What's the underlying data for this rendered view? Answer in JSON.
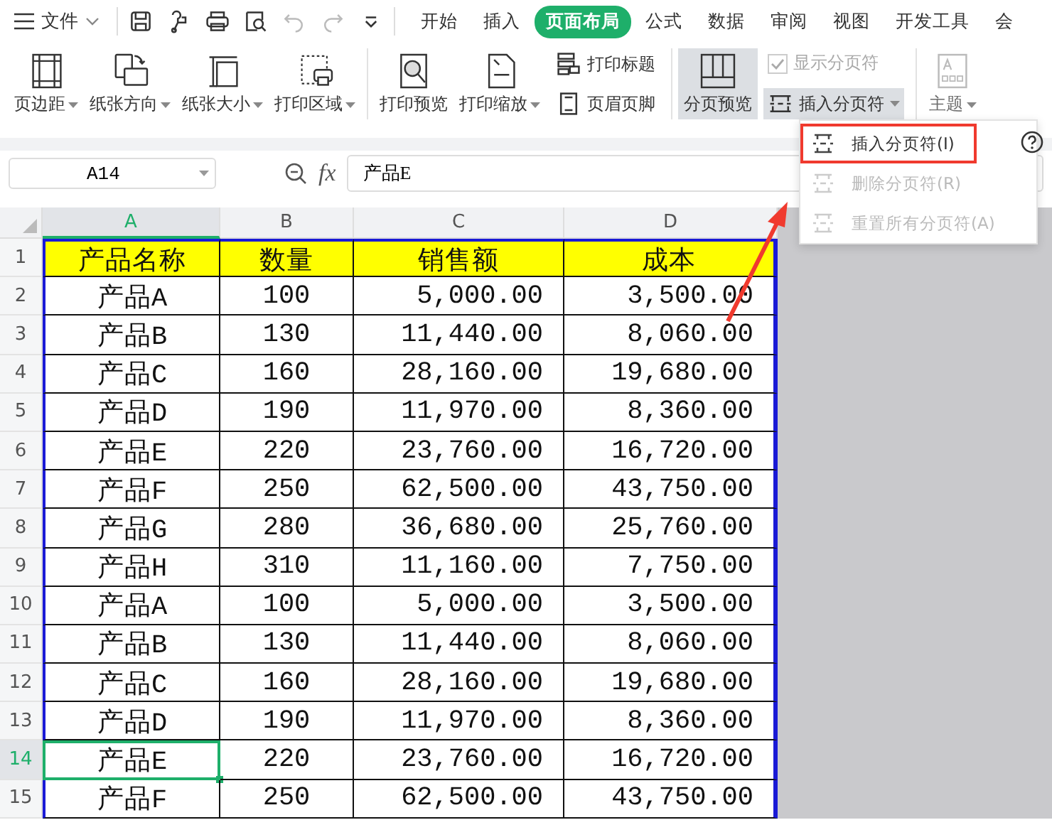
{
  "file_menu": {
    "label": "文件"
  },
  "quick_tools": [
    {
      "disabled": false
    },
    {
      "disabled": false
    },
    {
      "disabled": false
    },
    {
      "disabled": false
    },
    {
      "disabled": true
    },
    {
      "disabled": true
    },
    {
      "disabled": false
    }
  ],
  "tabs": [
    {
      "label": "开始",
      "selected": false
    },
    {
      "label": "插入",
      "selected": false
    },
    {
      "label": "页面布局",
      "selected": true
    },
    {
      "label": "公式",
      "selected": false
    },
    {
      "label": "数据",
      "selected": false
    },
    {
      "label": "审阅",
      "selected": false
    },
    {
      "label": "视图",
      "selected": false
    },
    {
      "label": "开发工具",
      "selected": false
    },
    {
      "label": "会",
      "selected": false
    }
  ],
  "ribbon": [
    {
      "kind": "large",
      "label": "页边距",
      "dropdown": true,
      "selected": false,
      "disabled": false
    },
    {
      "kind": "large",
      "label": "纸张方向",
      "dropdown": true,
      "selected": false,
      "disabled": false
    },
    {
      "kind": "large",
      "label": "纸张大小",
      "dropdown": true,
      "selected": false,
      "disabled": false
    },
    {
      "kind": "large",
      "label": "打印区域",
      "dropdown": true,
      "selected": false,
      "disabled": false
    },
    {
      "kind": "separator"
    },
    {
      "kind": "large",
      "label": "打印预览",
      "dropdown": false,
      "selected": false,
      "disabled": false
    },
    {
      "kind": "large",
      "label": "打印缩放",
      "dropdown": true,
      "selected": false,
      "disabled": false
    },
    {
      "kind": "stack",
      "items": [
        {
          "kind": "button",
          "label": "打印标题",
          "dropdown": false,
          "selected": false,
          "disabled": false
        },
        {
          "kind": "button",
          "label": "页眉页脚",
          "dropdown": false,
          "selected": false,
          "disabled": false
        }
      ]
    },
    {
      "kind": "separator"
    },
    {
      "kind": "large",
      "label": "分页预览",
      "dropdown": false,
      "selected": true,
      "disabled": false
    },
    {
      "kind": "stack",
      "items": [
        {
          "kind": "checkbox",
          "label": "显示分页符",
          "checked": true,
          "disabled": true
        },
        {
          "kind": "button",
          "label": "插入分页符",
          "dropdown": true,
          "selected": true,
          "disabled": false
        }
      ]
    },
    {
      "kind": "separator"
    },
    {
      "kind": "large",
      "label": "主题",
      "dropdown": true,
      "selected": false,
      "disabled": true
    }
  ],
  "name_box": {
    "value": "A14"
  },
  "formula_bar": {
    "fx": "fx",
    "value": "产品E"
  },
  "columns": [
    {
      "label": "A",
      "selected": true
    },
    {
      "label": "B",
      "selected": false
    },
    {
      "label": "C",
      "selected": false
    },
    {
      "label": "D",
      "selected": false
    }
  ],
  "rows": [
    {
      "number": "1",
      "selected": false,
      "header": true,
      "cells": [
        "产品名称",
        "数量",
        "销售额",
        "成本"
      ]
    },
    {
      "number": "2",
      "selected": false,
      "header": false,
      "cells": [
        "产品A",
        "100",
        "5,000.00",
        "3,500.00"
      ]
    },
    {
      "number": "3",
      "selected": false,
      "header": false,
      "cells": [
        "产品B",
        "130",
        "11,440.00",
        "8,060.00"
      ]
    },
    {
      "number": "4",
      "selected": false,
      "header": false,
      "cells": [
        "产品C",
        "160",
        "28,160.00",
        "19,680.00"
      ]
    },
    {
      "number": "5",
      "selected": false,
      "header": false,
      "cells": [
        "产品D",
        "190",
        "11,970.00",
        "8,360.00"
      ]
    },
    {
      "number": "6",
      "selected": false,
      "header": false,
      "cells": [
        "产品E",
        "220",
        "23,760.00",
        "16,720.00"
      ]
    },
    {
      "number": "7",
      "selected": false,
      "header": false,
      "cells": [
        "产品F",
        "250",
        "62,500.00",
        "43,750.00"
      ]
    },
    {
      "number": "8",
      "selected": false,
      "header": false,
      "cells": [
        "产品G",
        "280",
        "36,680.00",
        "25,760.00"
      ]
    },
    {
      "number": "9",
      "selected": false,
      "header": false,
      "cells": [
        "产品H",
        "310",
        "11,160.00",
        "7,750.00"
      ]
    },
    {
      "number": "10",
      "selected": false,
      "header": false,
      "cells": [
        "产品A",
        "100",
        "5,000.00",
        "3,500.00"
      ]
    },
    {
      "number": "11",
      "selected": false,
      "header": false,
      "cells": [
        "产品B",
        "130",
        "11,440.00",
        "8,060.00"
      ]
    },
    {
      "number": "12",
      "selected": false,
      "header": false,
      "cells": [
        "产品C",
        "160",
        "28,160.00",
        "19,680.00"
      ]
    },
    {
      "number": "13",
      "selected": false,
      "header": false,
      "cells": [
        "产品D",
        "190",
        "11,970.00",
        "8,360.00"
      ]
    },
    {
      "number": "14",
      "selected": true,
      "header": false,
      "cells": [
        "产品E",
        "220",
        "23,760.00",
        "16,720.00"
      ]
    },
    {
      "number": "15",
      "selected": false,
      "header": false,
      "cells": [
        "产品F",
        "250",
        "62,500.00",
        "43,750.00"
      ]
    }
  ],
  "dropdown_menu": {
    "items": [
      {
        "label": "插入分页符(I)",
        "disabled": false,
        "highlighted": true
      },
      {
        "label": "删除分页符(R)",
        "disabled": true,
        "highlighted": false
      },
      {
        "label": "重置所有分页符(A)",
        "disabled": true,
        "highlighted": false
      }
    ]
  }
}
